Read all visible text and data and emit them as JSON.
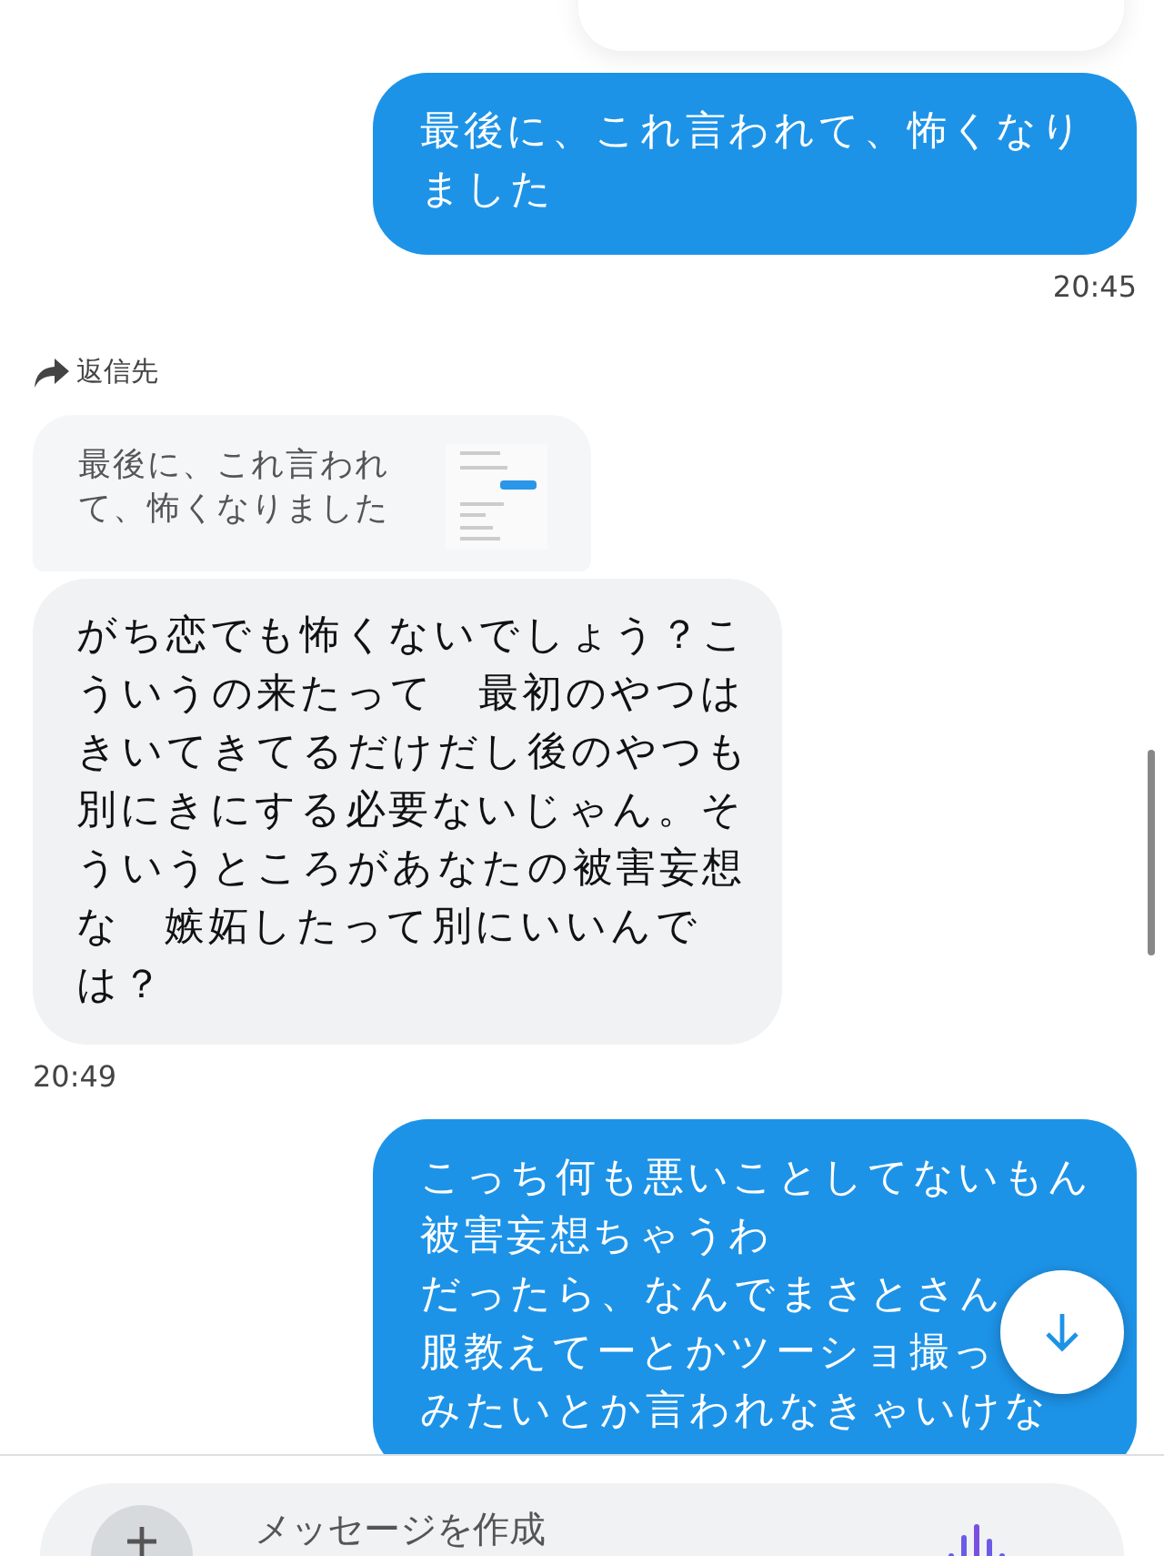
{
  "messages": [
    {
      "kind": "sent",
      "paragraphs": [
        "最後に、これ言われて、怖くなりました"
      ],
      "time": "20:45"
    },
    {
      "kind": "received",
      "reply_label": "返信先",
      "quote": "最後に、これ言われて、怖くなりました",
      "paragraphs": [
        "がち恋でも怖くないでしょう？こういうの来たって　最初のやつはきいてきてるだけだし後のやつも別にきにする必要ないじゃん。そういうところがあなたの被害妄想な　嫉妬したって別にいいんでは？"
      ],
      "time": "20:49"
    },
    {
      "kind": "sent",
      "paragraphs": [
        "こっち何も悪いことしてないもん",
        "被害妄想ちゃうわ",
        "だったら、なんでまさとさん",
        "服教えてーとかツーショ撮っ",
        "みたいとか言われなきゃいけな"
      ]
    }
  ],
  "composer": {
    "placeholder": "メッセージを作成"
  }
}
